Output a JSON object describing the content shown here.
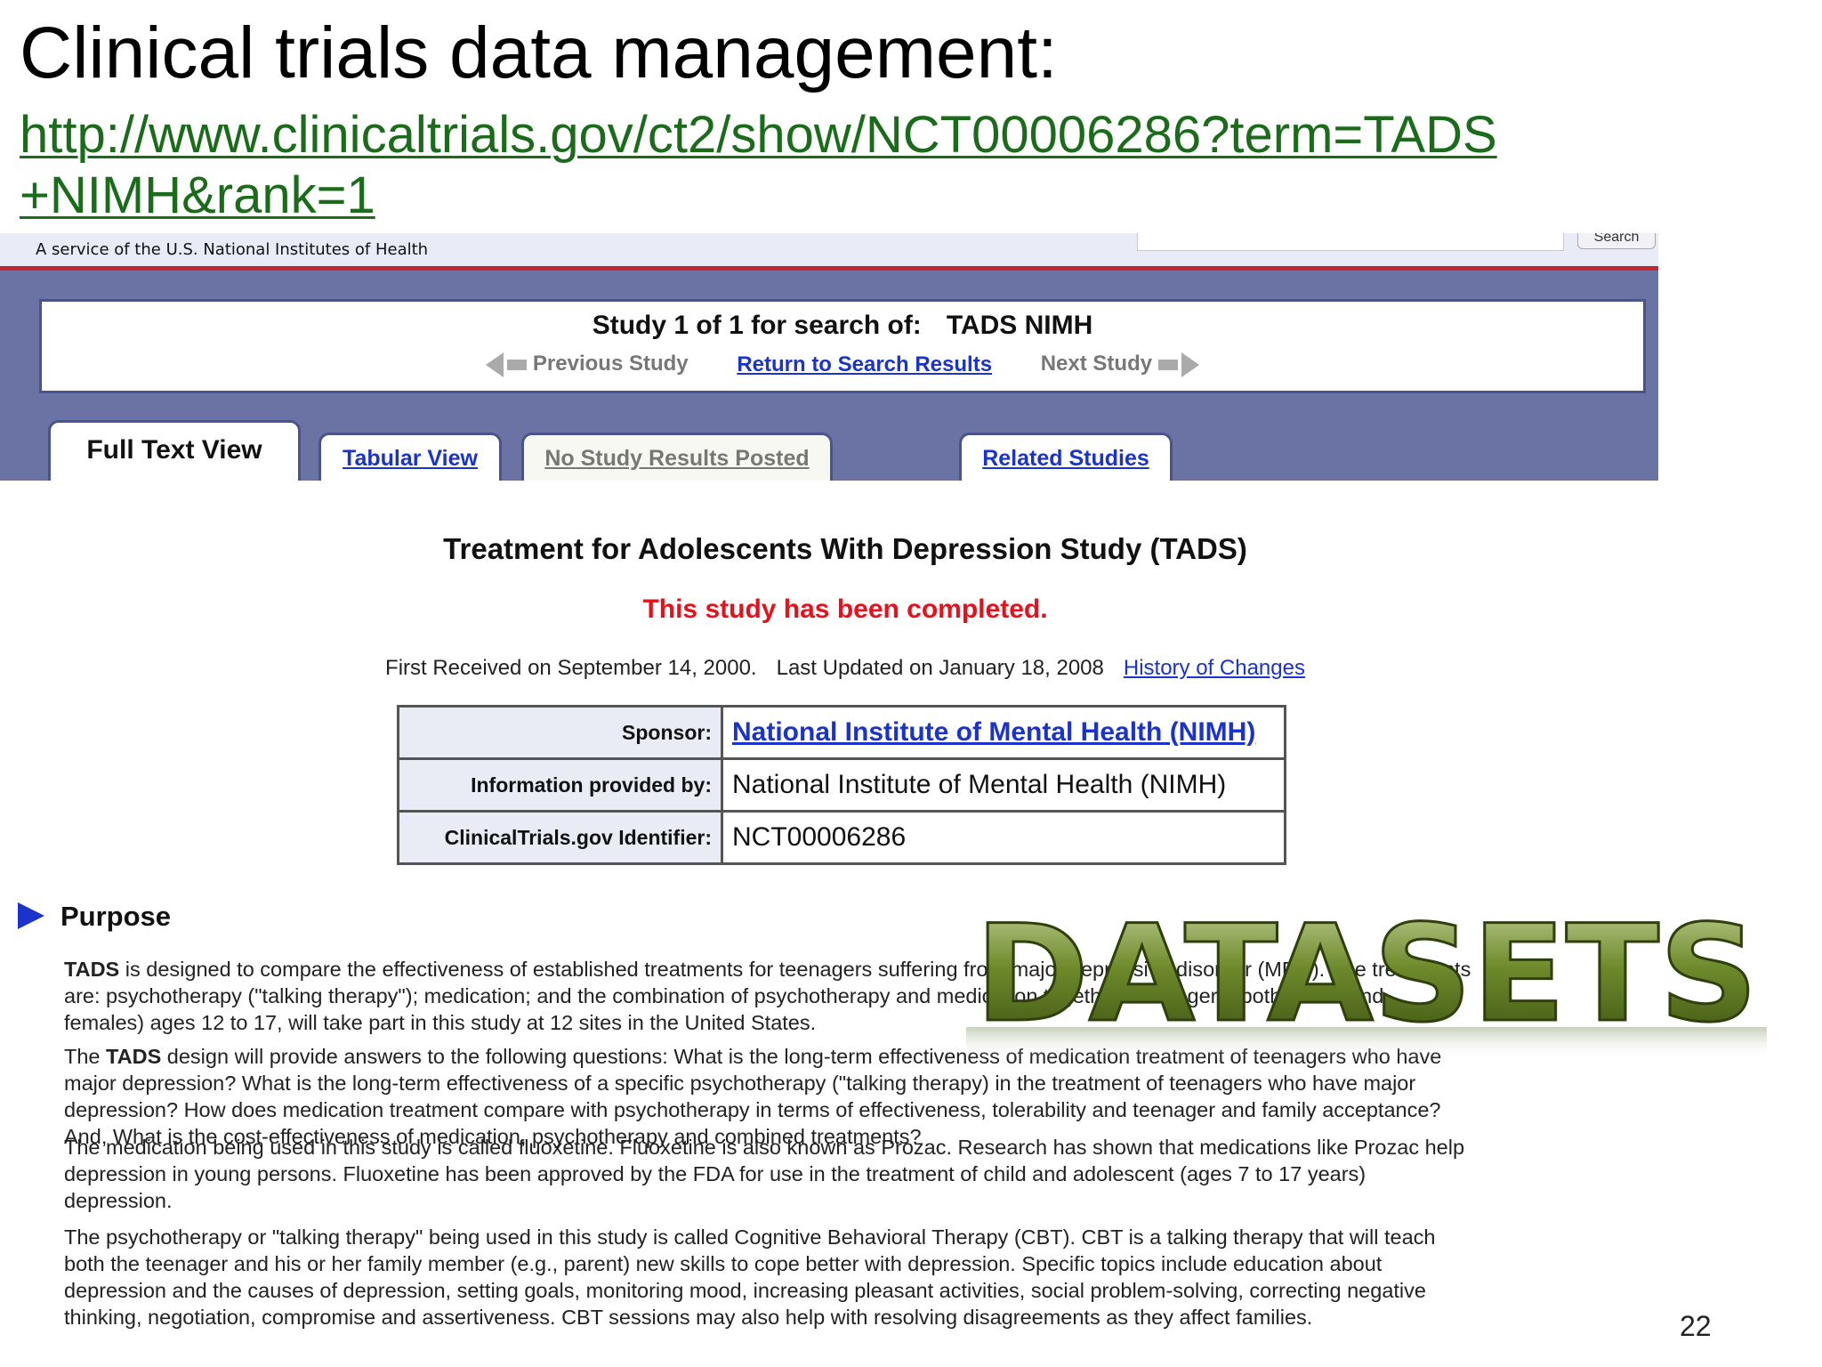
{
  "slide": {
    "title": "Clinical trials data management:",
    "url_line1": "http://www.clinicaltrials.gov/ct2/show/NCT00006286?term=TADS",
    "url_line2": "+NIMH&rank=1",
    "page_number": "22",
    "overlay_word": "DATASETS",
    "overlay_color": "#4f6a1c"
  },
  "header": {
    "service_text": "A service of the U.S. National Institutes of Health",
    "search_button": "Search"
  },
  "study_nav": {
    "prefix": "Study 1 of 1 for search of:",
    "query": "TADS NIMH",
    "previous": "Previous Study",
    "return": "Return to Search Results",
    "next": "Next Study"
  },
  "tabs": [
    {
      "label": "Full Text View",
      "active": true
    },
    {
      "label": "Tabular View",
      "active": false
    },
    {
      "label": "No Study Results Posted",
      "active": false
    },
    {
      "label": "Related Studies",
      "active": false
    }
  ],
  "trial": {
    "title": "Treatment for Adolescents With Depression Study (TADS)",
    "status": "This study has been completed.",
    "first_received": "First Received on September 14, 2000.",
    "last_updated": "Last Updated on January 18, 2008",
    "history_link": "History of Changes",
    "table": [
      {
        "label": "Sponsor:",
        "value": "National Institute of Mental Health (NIMH)",
        "link": true
      },
      {
        "label": "Information provided by:",
        "value": "National Institute of Mental Health (NIMH)",
        "link": false
      },
      {
        "label": "ClinicalTrials.gov Identifier:",
        "value": "NCT00006286",
        "link": false
      }
    ]
  },
  "purpose": {
    "heading": "Purpose",
    "p1": [
      "TADS is designed to compare the effectiveness of established treatments for teenagers suffering from major depressive disorder (MDD). The treatments",
      "are: psychotherapy (\"talking therapy\"); medication; and the combination of psychotherapy and medication together. Teenagers (both males and",
      "females) ages 12 to 17, will take part in this study at 12 sites in the United States."
    ],
    "p2": [
      "The TADS design will provide answers to the following questions: What is the long-term effectiveness of medication treatment of teenagers who have",
      "major depression? What is the long-term effectiveness of a specific psychotherapy (\"talking therapy) in the treatment of teenagers who have major",
      "depression? How does medication treatment compare with psychotherapy in terms of effectiveness, tolerability and teenager and family acceptance?",
      "And, What is the cost-effectiveness of medication, psychotherapy and combined treatments?"
    ],
    "p3": [
      "The medication being used in this study is called fluoxetine. Fluoxetine is also known as Prozac. Research has shown that medications like Prozac help",
      "depression in young persons. Fluoxetine has been approved by the FDA for use in the treatment of child and adolescent (ages 7 to 17 years)",
      "depression."
    ],
    "p4": [
      "The psychotherapy or \"talking therapy\" being used in this study is called Cognitive Behavioral Therapy (CBT). CBT is a talking therapy that will teach",
      "both the teenager and his or her family member (e.g., parent) new skills to cope better with depression. Specific topics include education about",
      "depression and the causes of depression, setting goals, monitoring mood, increasing pleasant activities, social problem-solving, correcting negative",
      "thinking, negotiation, compromise and assertiveness. CBT sessions may also help with resolving disagreements as they affect families."
    ]
  }
}
